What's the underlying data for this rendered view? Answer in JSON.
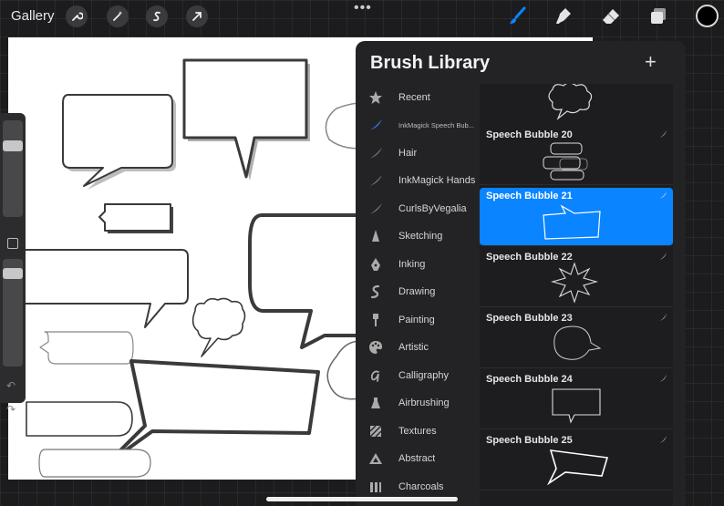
{
  "toolbar": {
    "gallery_label": "Gallery",
    "more_label": "•••",
    "left_tools": [
      "wrench-icon",
      "magic-wand-icon",
      "selection-icon",
      "transform-arrow-icon"
    ],
    "right_tools": [
      "paintbrush-icon",
      "smudge-icon",
      "eraser-icon",
      "layers-icon"
    ],
    "active_tool": "paintbrush-icon",
    "accent_color": "#0a84ff",
    "current_color": "#000000"
  },
  "sidebar": {
    "undo_icon": "↶",
    "redo_icon": "↷"
  },
  "brush_library": {
    "title": "Brush Library",
    "add_label": "+",
    "sets": [
      {
        "label": "Recent",
        "icon": "star-icon"
      },
      {
        "label": "InkMagick Speech Bub...",
        "icon": "blue-brush-icon",
        "active": true
      },
      {
        "label": "Hair",
        "icon": "brush-stroke-icon"
      },
      {
        "label": "InkMagick Hands",
        "icon": "brush-stroke-icon"
      },
      {
        "label": "CurlsByVegalia",
        "icon": "brush-stroke-icon"
      },
      {
        "label": "Sketching",
        "icon": "pencil-tip-icon"
      },
      {
        "label": "Inking",
        "icon": "pen-nib-icon"
      },
      {
        "label": "Drawing",
        "icon": "squiggle-icon"
      },
      {
        "label": "Painting",
        "icon": "paint-brush-icon"
      },
      {
        "label": "Artistic",
        "icon": "palette-icon"
      },
      {
        "label": "Calligraphy",
        "icon": "calligraphy-a-icon"
      },
      {
        "label": "Airbrushing",
        "icon": "airbrush-icon"
      },
      {
        "label": "Textures",
        "icon": "texture-icon"
      },
      {
        "label": "Abstract",
        "icon": "triangle-icon"
      },
      {
        "label": "Charcoals",
        "icon": "charcoal-icon"
      }
    ],
    "brushes": [
      {
        "name": "Speech Bubble 20"
      },
      {
        "name": "Speech Bubble 21",
        "selected": true
      },
      {
        "name": "Speech Bubble 22"
      },
      {
        "name": "Speech Bubble 23"
      },
      {
        "name": "Speech Bubble 24"
      },
      {
        "name": "Speech Bubble 25"
      }
    ]
  }
}
